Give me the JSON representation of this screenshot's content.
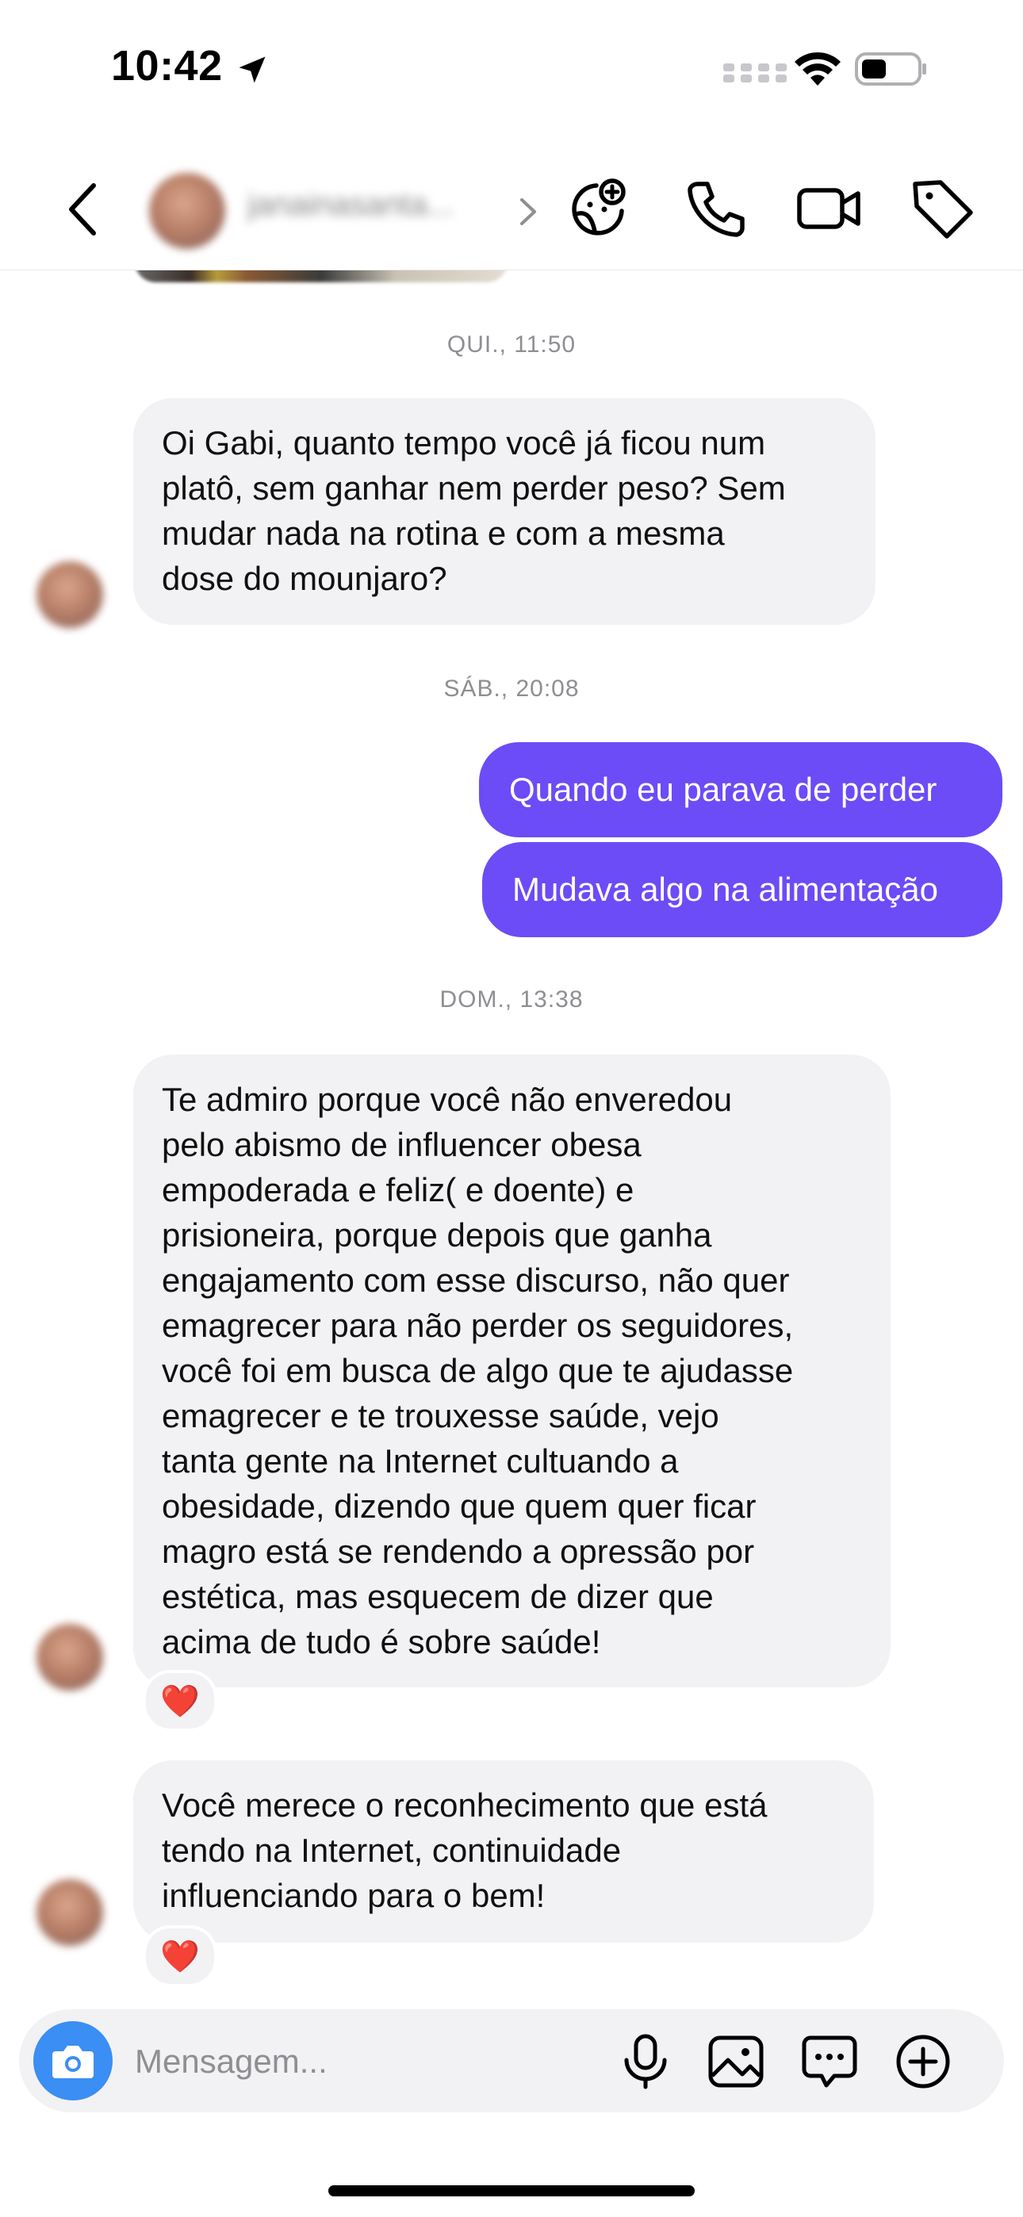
{
  "status_bar": {
    "time": "10:42"
  },
  "header": {
    "username": "janainasanta...",
    "icons": [
      "back-icon",
      "chevron-right-icon",
      "sticker-plus-icon",
      "phone-icon",
      "video-camera-icon",
      "tag-icon"
    ]
  },
  "conversation": {
    "stamps": [
      "QUI., 11:50",
      "SÁB., 20:08",
      "DOM., 13:38"
    ],
    "msg1": [
      "Oi Gabi, quanto tempo você já ficou num",
      "platô, sem ganhar nem perder peso? Sem",
      "mudar nada na rotina e com a mesma",
      "dose do mounjaro?"
    ],
    "sent1": "Quando eu parava de perder",
    "sent2": "Mudava algo na alimentação",
    "msg2": [
      "Te admiro porque você não enveredou",
      "pelo abismo de influencer obesa",
      "empoderada e feliz( e doente) e",
      "prisioneira, porque depois que ganha",
      "engajamento com esse discurso, não quer",
      "emagrecer para não perder os seguidores,",
      "você foi em busca de algo que te ajudasse",
      "emagrecer e te trouxesse saúde, vejo",
      "tanta gente na Internet cultuando a",
      "obesidade, dizendo que quem quer ficar",
      "magro está se rendendo a opressão por",
      "estética, mas esquecem de dizer que",
      "acima de tudo é sobre saúde!"
    ],
    "msg3": [
      "Você merece  o reconhecimento que está",
      "tendo na Internet, continuidade",
      "influenciando para o bem!"
    ],
    "reaction": "❤️"
  },
  "composer": {
    "placeholder": "Mensagem...",
    "icons": [
      "camera-icon",
      "microphone-icon",
      "gallery-icon",
      "chat-bubble-icon",
      "plus-icon"
    ]
  },
  "colors": {
    "sent_bubble": "#6b4cf6",
    "received_bubble": "#f2f2f4",
    "camera_button": "#3b8ef3",
    "timestamp": "#8e8e93"
  }
}
